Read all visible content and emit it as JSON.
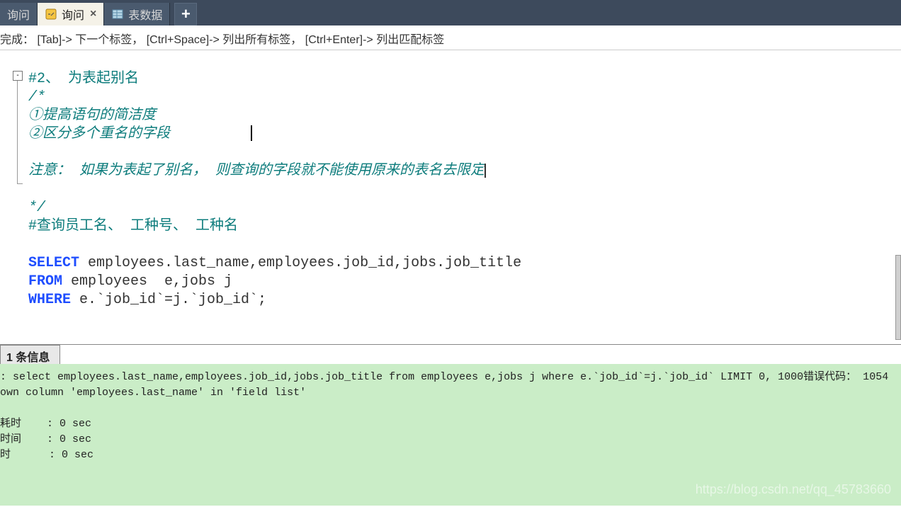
{
  "tabs": {
    "t0": "询问",
    "t1": "询问",
    "t2": "表数据"
  },
  "hint": "完成： [Tab]-> 下一个标签， [Ctrl+Space]-> 列出所有标签， [Ctrl+Enter]-> 列出匹配标签",
  "fold_symbol": "-",
  "code": {
    "l1": "#2、 为表起别名",
    "l2": "/*",
    "l3": "①提高语句的简洁度",
    "l4": "②区分多个重名的字段",
    "l5": "",
    "l6": "注意： 如果为表起了别名， 则查询的字段就不能使用原来的表名去限定",
    "l7": "",
    "l8": "*/",
    "l9": "#查询员工名、 工种号、 工种名",
    "l10": "",
    "sql": {
      "sel": "SELECT",
      "sel_cols": " employees.last_name,employees.job_id,jobs.job_title",
      "from": "FROM",
      "from_t": " employees  e,jobs j",
      "where": "WHERE",
      "where_c": " e.`job_id`=j.`job_id`;"
    }
  },
  "msgtab": "1 条信息",
  "msg": {
    "l1": ": select employees.last_name,employees.job_id,jobs.job_title from employees e,jobs j where e.`job_id`=j.`job_id` LIMIT 0, 1000错误代码： 1054",
    "l2": "own column 'employees.last_name' in 'field list'",
    "l3": "",
    "l4": "耗时    : 0 sec",
    "l5": "时间    : 0 sec",
    "l6": "时      : 0 sec"
  },
  "watermark": "https://blog.csdn.net/qq_45783660"
}
